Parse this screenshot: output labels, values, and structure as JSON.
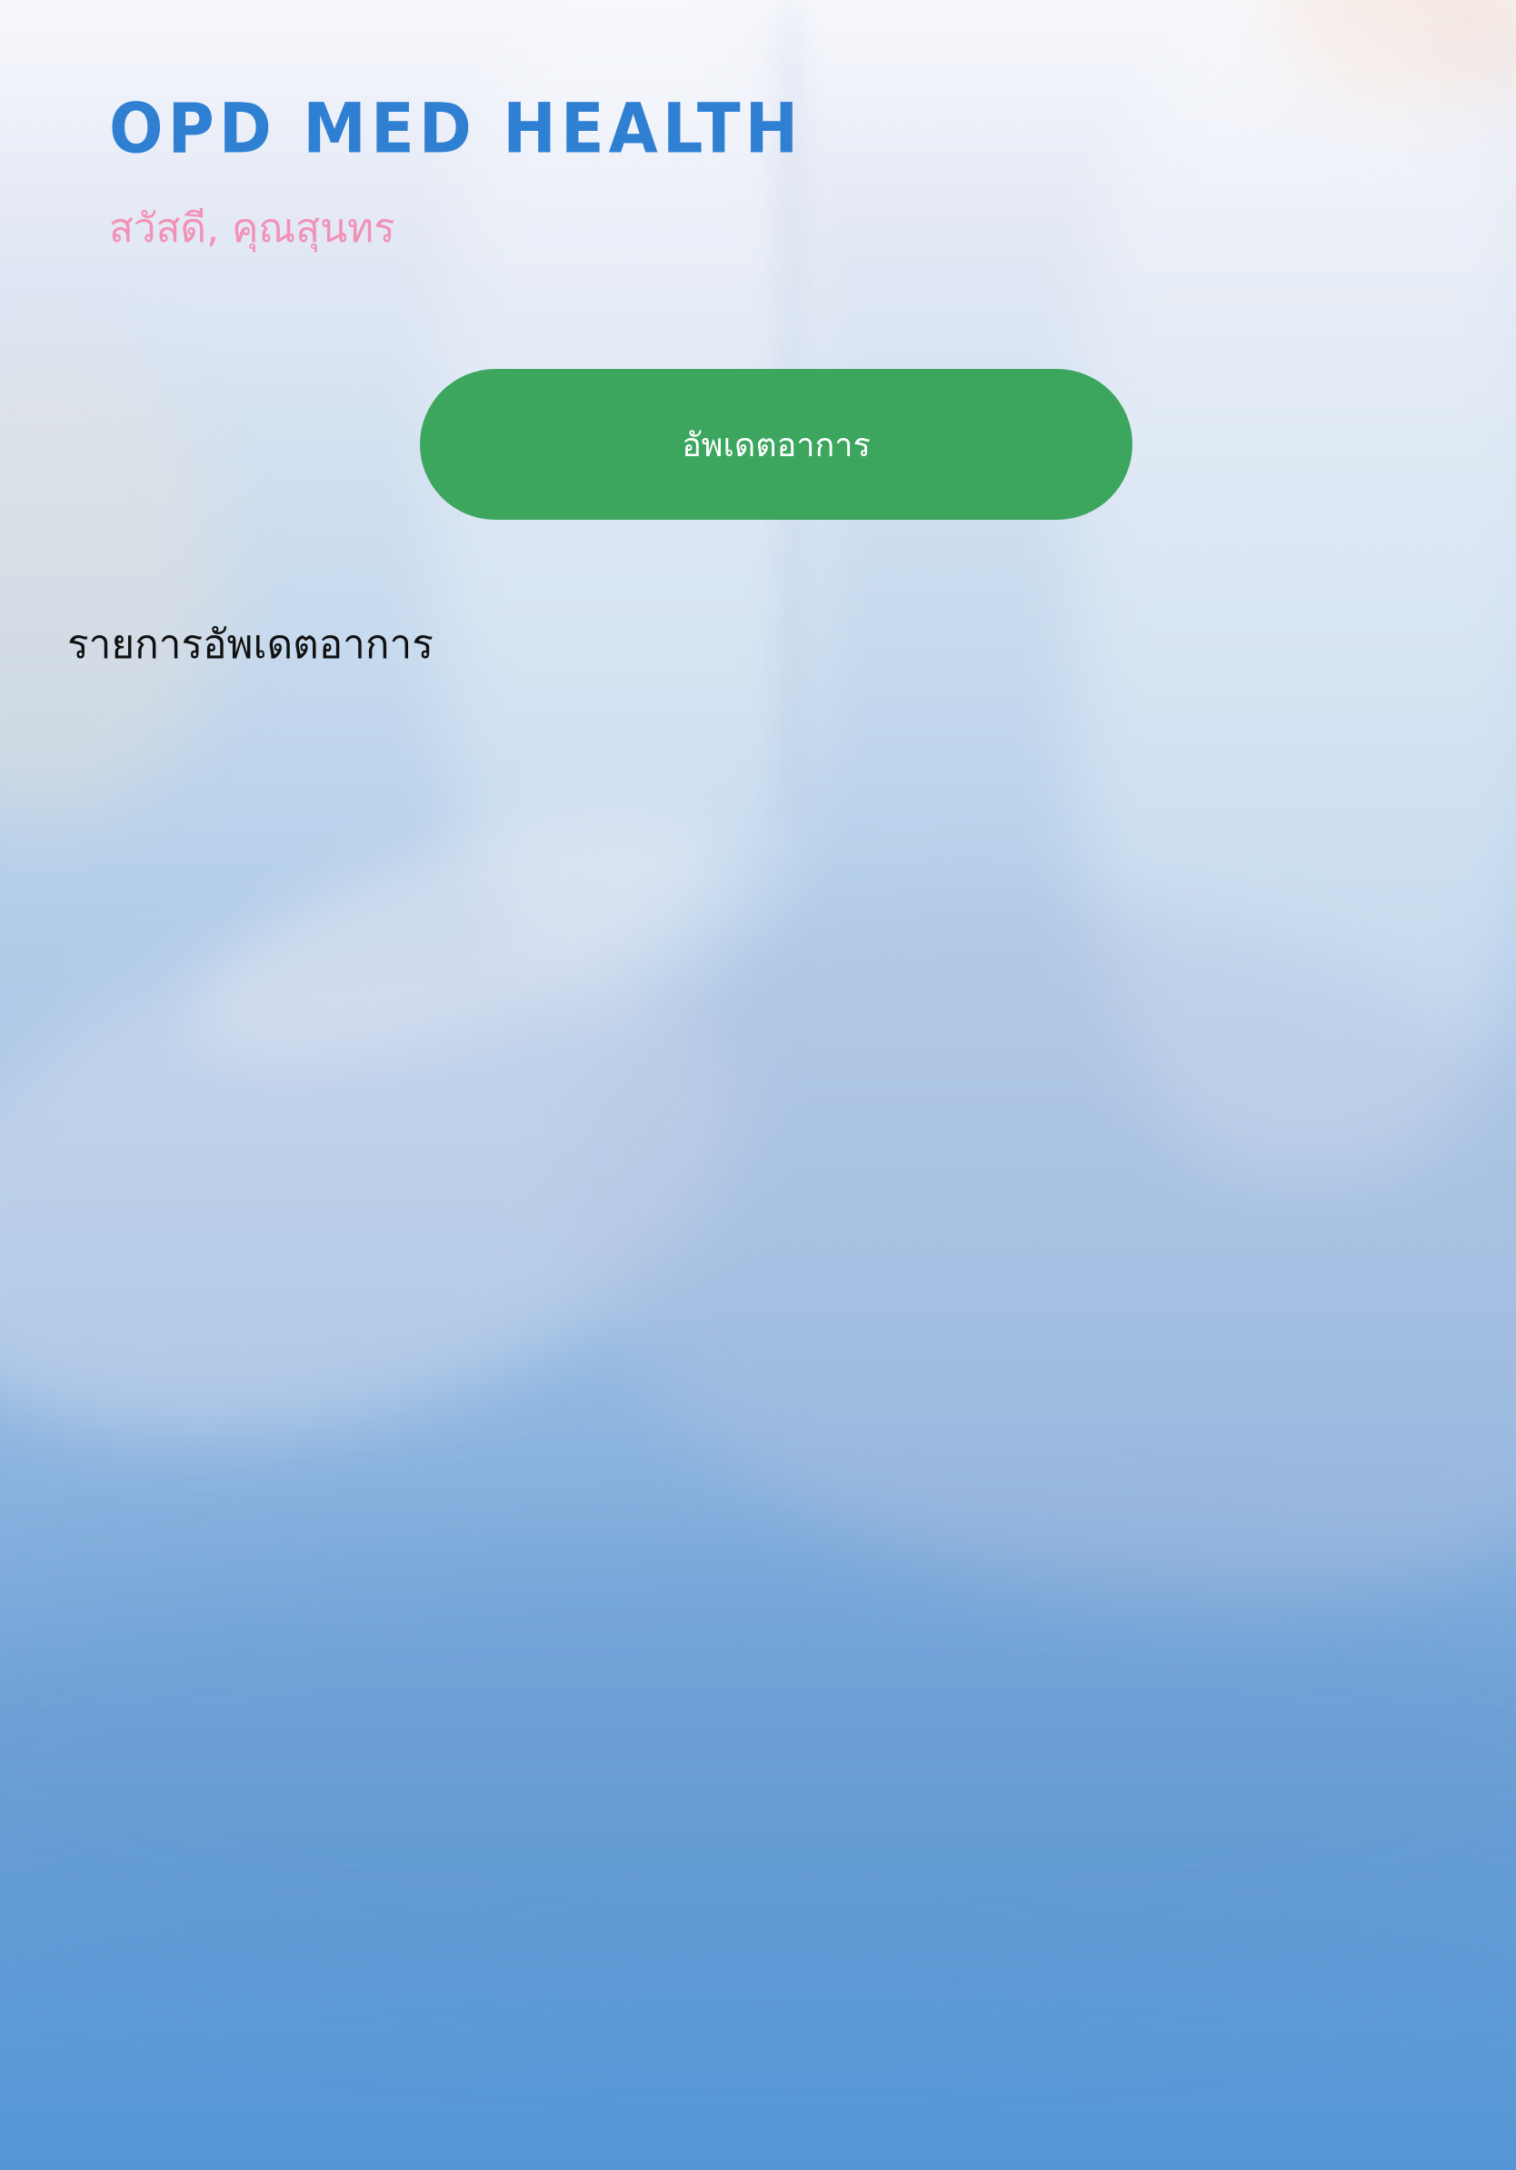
{
  "app": {
    "brand": "OPD MED HEALTH",
    "greeting": "สวัสดี, คุณสุนทร"
  },
  "actions": {
    "update_button_label": "อัพเดตอาการ"
  },
  "updates": {
    "section_title": "รายการอัพเดตอาการ",
    "items": []
  },
  "colors": {
    "brand": "#2f7fd3",
    "greeting": "#f291b6",
    "primary_button": "#3ca65f",
    "background_top": "#f7f8fc",
    "background_bottom": "#5396d6"
  }
}
